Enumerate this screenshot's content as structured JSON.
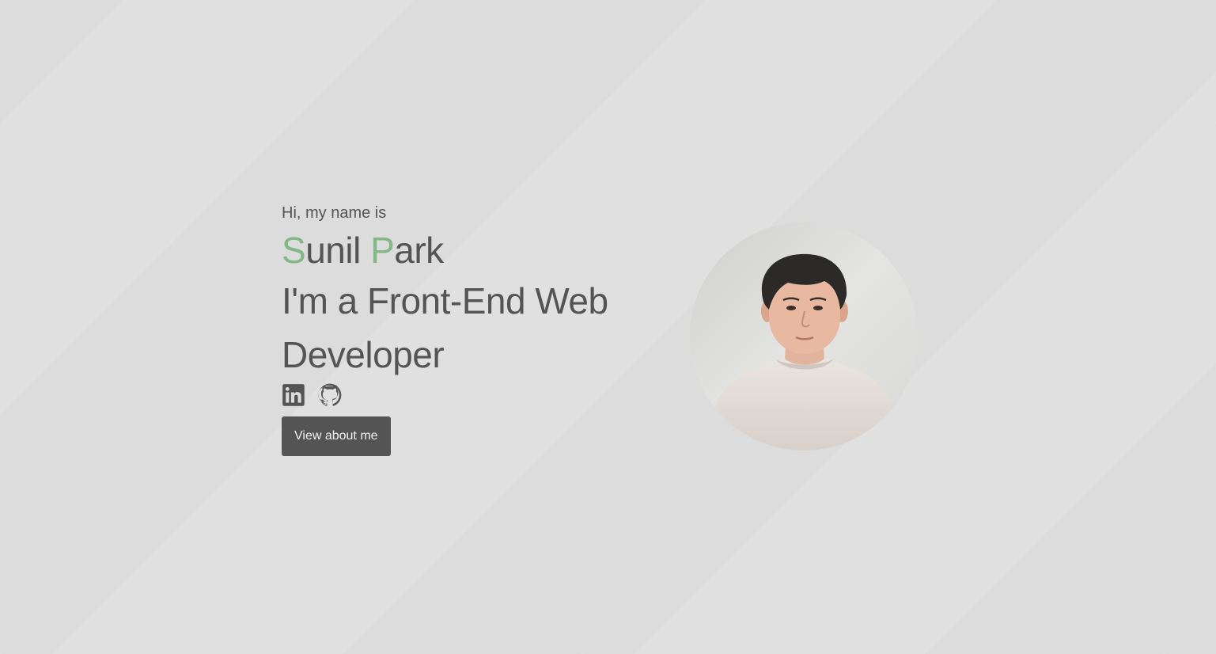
{
  "hero": {
    "greeting": "Hi, my name is",
    "name_first_initial": "S",
    "name_first_rest": "unil",
    "name_last_initial": "P",
    "name_last_rest": "ark",
    "role_line1": "I'm a Front-End Web",
    "role_line2": "Developer",
    "cta_label": "View about me"
  },
  "socials": [
    {
      "icon": "linkedin-icon"
    },
    {
      "icon": "github-icon"
    }
  ],
  "colors": {
    "background": "#e0e0e0",
    "text": "#545454",
    "accent": "#82b886",
    "button_bg": "#545454",
    "button_text": "#f2f2f2"
  }
}
